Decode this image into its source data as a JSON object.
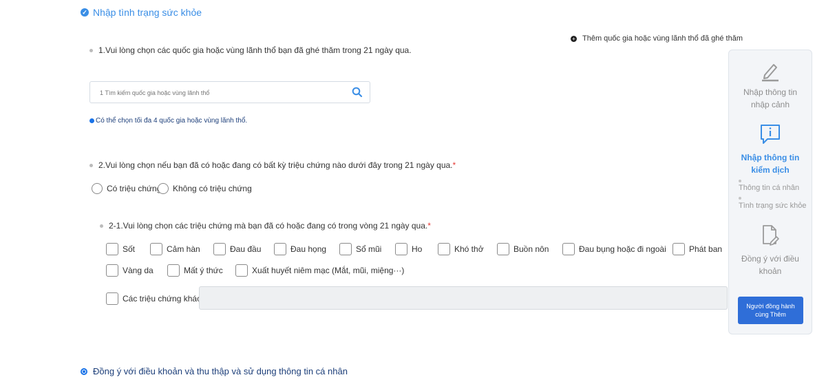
{
  "section_health": {
    "title": "Nhập tình trạng sức khỏe"
  },
  "add_country": {
    "label": "Thêm quốc gia hoặc vùng lãnh thổ đã ghé thăm"
  },
  "q1": {
    "label": "1.Vui lòng chọn các quốc gia hoặc vùng lãnh thổ bạn đã ghé thăm trong 21 ngày qua.",
    "search_placeholder": "1 Tìm kiếm quốc gia hoặc vùng lãnh thổ",
    "info": "Có thể chọn tối đa 4 quốc gia hoặc vùng lãnh thổ."
  },
  "q2": {
    "label": "2.Vui lòng chọn nếu bạn đã có hoặc đang có bất kỳ triệu chứng nào dưới đây trong 21 ngày qua.",
    "required_mark": "*",
    "options": [
      "Có triệu chứng",
      "Không có triệu chứng"
    ]
  },
  "q2_1": {
    "label": "2-1.Vui lòng chọn các triệu chứng mà bạn đã có hoặc đang có trong vòng 21 ngày qua.",
    "required_mark": "*",
    "symptoms": [
      "Sốt",
      "Cảm hàn",
      "Đau đầu",
      "Đau họng",
      "Sổ mũi",
      "Ho",
      "Khó thở",
      "Buồn nôn",
      "Đau bụng hoặc đi ngoài",
      "Phát ban",
      "Vàng da",
      "Mất ý thức",
      "Xuất huyết niêm mạc (Mắt, mũi, miệng···)"
    ],
    "other_label": "Các triệu chứng khác",
    "other_value": ""
  },
  "sidebar": {
    "step1": [
      "Nhập thông tin",
      "nhập cảnh"
    ],
    "step2": [
      "Nhập thông tin",
      "kiểm dịch"
    ],
    "step2_subs": [
      "Thông tin cá nhân",
      "Tình trạng sức khỏe"
    ],
    "step3": [
      "Đồng ý với điều",
      "khoản"
    ],
    "button": [
      "Người đồng hành",
      "cùng Thêm"
    ]
  },
  "section_consent": {
    "title": "Đồng ý với điều khoản và thu thập và sử dụng thông tin cá nhân"
  },
  "colors": {
    "accent": "#3a8ee6",
    "button": "#2f6ed8",
    "required": "#e53935"
  }
}
